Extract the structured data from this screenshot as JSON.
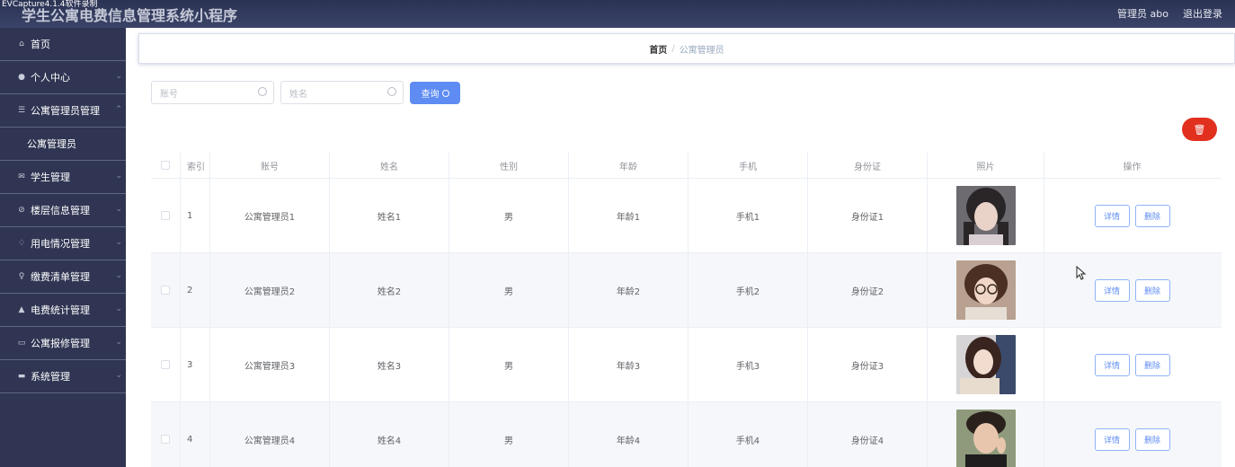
{
  "capture_label": "EVCapture4.1.4软件录制",
  "app_title": "学生公寓电费信息管理系统小程序",
  "header": {
    "admin_label": "管理员 abo",
    "logout_label": "退出登录"
  },
  "sidebar": {
    "items": [
      {
        "label": "首页",
        "icon": "home-icon",
        "glyph": "⌂"
      },
      {
        "label": "个人中心",
        "icon": "user-icon",
        "glyph": "●",
        "chevron": "⌄"
      },
      {
        "label": "公寓管理员管理",
        "icon": "list-icon",
        "glyph": "☰",
        "chevron": "⌃"
      },
      {
        "label": "学生管理",
        "icon": "mail-icon",
        "glyph": "✉",
        "chevron": "⌄"
      },
      {
        "label": "楼层信息管理",
        "icon": "compass-icon",
        "glyph": "⊘",
        "chevron": "⌄"
      },
      {
        "label": "用电情况管理",
        "icon": "bell-icon",
        "glyph": "♢",
        "chevron": "⌄"
      },
      {
        "label": "缴费清单管理",
        "icon": "mic-icon",
        "glyph": "♀",
        "chevron": "⌄"
      },
      {
        "label": "电费统计管理",
        "icon": "thumb-icon",
        "glyph": "▲",
        "chevron": "⌄"
      },
      {
        "label": "公寓报修管理",
        "icon": "chat-icon",
        "glyph": "▭",
        "chevron": "⌄"
      },
      {
        "label": "系统管理",
        "icon": "monitor-icon",
        "glyph": "▬",
        "chevron": "⌄"
      }
    ],
    "sub_item": "公寓管理员"
  },
  "breadcrumb": {
    "home": "首页",
    "separator": "/",
    "current": "公寓管理员"
  },
  "search": {
    "account_placeholder": "账号",
    "name_placeholder": "姓名",
    "button_label": "查询",
    "button_icon": "search-icon"
  },
  "delete_button_icon": "trash-icon",
  "delete_glyph": "🗑",
  "table": {
    "headers": [
      "索引",
      "账号",
      "姓名",
      "性别",
      "年龄",
      "手机",
      "身份证",
      "照片",
      "操作"
    ],
    "rows": [
      {
        "index": "1",
        "account": "公寓管理员1",
        "name": "姓名1",
        "gender": "男",
        "age": "年龄1",
        "phone": "手机1",
        "id_card": "身份证1"
      },
      {
        "index": "2",
        "account": "公寓管理员2",
        "name": "姓名2",
        "gender": "男",
        "age": "年龄2",
        "phone": "手机2",
        "id_card": "身份证2"
      },
      {
        "index": "3",
        "account": "公寓管理员3",
        "name": "姓名3",
        "gender": "男",
        "age": "年龄3",
        "phone": "手机3",
        "id_card": "身份证3"
      },
      {
        "index": "4",
        "account": "公寓管理员4",
        "name": "姓名4",
        "gender": "男",
        "age": "年龄4",
        "phone": "手机4",
        "id_card": "身份证4"
      }
    ],
    "detail_label": "详情",
    "delete_label": "删除"
  },
  "colors": {
    "header_bg": "#2b3354",
    "sidebar_bg": "#2f3552",
    "primary": "#5e8cf2",
    "danger": "#e2301f"
  }
}
